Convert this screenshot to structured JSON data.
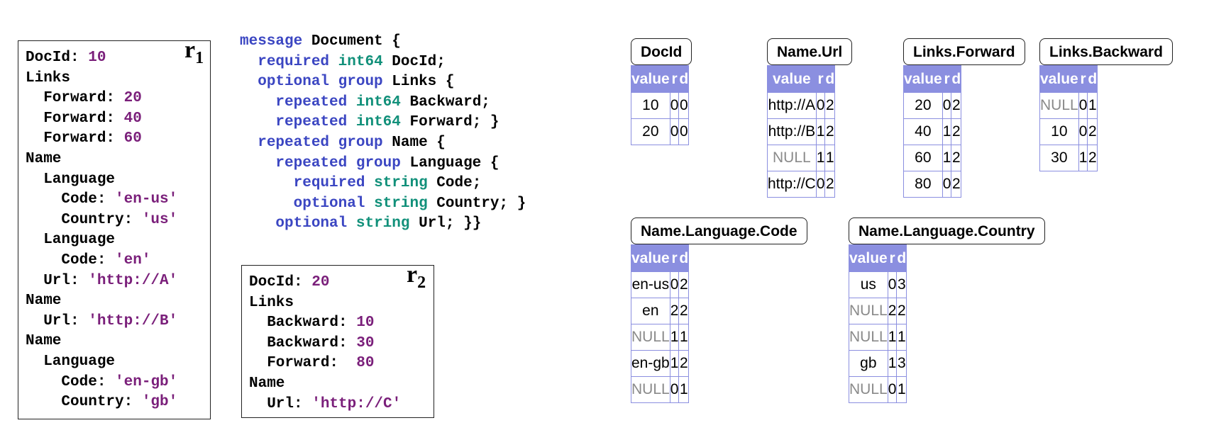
{
  "records": [
    {
      "label": "r",
      "sub": "1",
      "lines": [
        {
          "k": "DocId: ",
          "v": "10"
        },
        {
          "k": "Links",
          "v": ""
        },
        {
          "k": "  Forward: ",
          "v": "20"
        },
        {
          "k": "  Forward: ",
          "v": "40"
        },
        {
          "k": "  Forward: ",
          "v": "60"
        },
        {
          "k": "Name",
          "v": ""
        },
        {
          "k": "  Language",
          "v": ""
        },
        {
          "k": "    Code: ",
          "v": "'en-us'"
        },
        {
          "k": "    Country: ",
          "v": "'us'"
        },
        {
          "k": "  Language",
          "v": ""
        },
        {
          "k": "    Code: ",
          "v": "'en'"
        },
        {
          "k": "  Url: ",
          "v": "'http://A'"
        },
        {
          "k": "Name",
          "v": ""
        },
        {
          "k": "  Url: ",
          "v": "'http://B'"
        },
        {
          "k": "Name",
          "v": ""
        },
        {
          "k": "  Language",
          "v": ""
        },
        {
          "k": "    Code: ",
          "v": "'en-gb'"
        },
        {
          "k": "    Country: ",
          "v": "'gb'"
        }
      ]
    },
    {
      "label": "r",
      "sub": "2",
      "lines": [
        {
          "k": "DocId: ",
          "v": "20"
        },
        {
          "k": "Links",
          "v": ""
        },
        {
          "k": "  Backward: ",
          "v": "10"
        },
        {
          "k": "  Backward: ",
          "v": "30"
        },
        {
          "k": "  Forward:  ",
          "v": "80"
        },
        {
          "k": "Name",
          "v": ""
        },
        {
          "k": "  Url: ",
          "v": "'http://C'"
        }
      ]
    }
  ],
  "schema": [
    [
      {
        "t": "message",
        "c": "kw"
      },
      {
        "t": " Document {",
        "c": ""
      }
    ],
    [
      {
        "t": "  ",
        "c": ""
      },
      {
        "t": "required",
        "c": "kw"
      },
      {
        "t": " ",
        "c": ""
      },
      {
        "t": "int64",
        "c": "ty"
      },
      {
        "t": " DocId;",
        "c": ""
      }
    ],
    [
      {
        "t": "  ",
        "c": ""
      },
      {
        "t": "optional group",
        "c": "kw"
      },
      {
        "t": " Links {",
        "c": ""
      }
    ],
    [
      {
        "t": "    ",
        "c": ""
      },
      {
        "t": "repeated",
        "c": "kw"
      },
      {
        "t": " ",
        "c": ""
      },
      {
        "t": "int64",
        "c": "ty"
      },
      {
        "t": " Backward;",
        "c": ""
      }
    ],
    [
      {
        "t": "    ",
        "c": ""
      },
      {
        "t": "repeated",
        "c": "kw"
      },
      {
        "t": " ",
        "c": ""
      },
      {
        "t": "int64",
        "c": "ty"
      },
      {
        "t": " Forward; }",
        "c": ""
      }
    ],
    [
      {
        "t": "  ",
        "c": ""
      },
      {
        "t": "repeated group",
        "c": "kw"
      },
      {
        "t": " Name {",
        "c": ""
      }
    ],
    [
      {
        "t": "    ",
        "c": ""
      },
      {
        "t": "repeated group",
        "c": "kw"
      },
      {
        "t": " Language {",
        "c": ""
      }
    ],
    [
      {
        "t": "      ",
        "c": ""
      },
      {
        "t": "required",
        "c": "kw"
      },
      {
        "t": " ",
        "c": ""
      },
      {
        "t": "string",
        "c": "ty"
      },
      {
        "t": " Code;",
        "c": ""
      }
    ],
    [
      {
        "t": "      ",
        "c": ""
      },
      {
        "t": "optional",
        "c": "kw"
      },
      {
        "t": " ",
        "c": ""
      },
      {
        "t": "string",
        "c": "ty"
      },
      {
        "t": " Country; }",
        "c": ""
      }
    ],
    [
      {
        "t": "    ",
        "c": ""
      },
      {
        "t": "optional",
        "c": "kw"
      },
      {
        "t": " ",
        "c": ""
      },
      {
        "t": "string",
        "c": "ty"
      },
      {
        "t": " Url; }}",
        "c": ""
      }
    ]
  ],
  "column_headers": {
    "value": "value",
    "r": "r",
    "d": "d"
  },
  "columns": [
    {
      "title": "DocId",
      "rows": [
        [
          "10",
          "0",
          "0"
        ],
        [
          "20",
          "0",
          "0"
        ]
      ]
    },
    {
      "title": "Name.Url",
      "rows": [
        [
          "http://A",
          "0",
          "2"
        ],
        [
          "http://B",
          "1",
          "2"
        ],
        [
          "NULL",
          "1",
          "1"
        ],
        [
          "http://C",
          "0",
          "2"
        ]
      ]
    },
    {
      "title": "Links.Forward",
      "rows": [
        [
          "20",
          "0",
          "2"
        ],
        [
          "40",
          "1",
          "2"
        ],
        [
          "60",
          "1",
          "2"
        ],
        [
          "80",
          "0",
          "2"
        ]
      ]
    },
    {
      "title": "Links.Backward",
      "rows": [
        [
          "NULL",
          "0",
          "1"
        ],
        [
          "10",
          "0",
          "2"
        ],
        [
          "30",
          "1",
          "2"
        ]
      ]
    },
    {
      "title": "Name.Language.Code",
      "rows": [
        [
          "en-us",
          "0",
          "2"
        ],
        [
          "en",
          "2",
          "2"
        ],
        [
          "NULL",
          "1",
          "1"
        ],
        [
          "en-gb",
          "1",
          "2"
        ],
        [
          "NULL",
          "0",
          "1"
        ]
      ]
    },
    {
      "title": "Name.Language.Country",
      "rows": [
        [
          "us",
          "0",
          "3"
        ],
        [
          "NULL",
          "2",
          "2"
        ],
        [
          "NULL",
          "1",
          "1"
        ],
        [
          "gb",
          "1",
          "3"
        ],
        [
          "NULL",
          "0",
          "1"
        ]
      ]
    }
  ],
  "colors": {
    "keyword": "#3b46c2",
    "type": "#11907a",
    "value": "#7a1f7a",
    "header": "#8b8fe0",
    "null": "#8a8a8a"
  }
}
